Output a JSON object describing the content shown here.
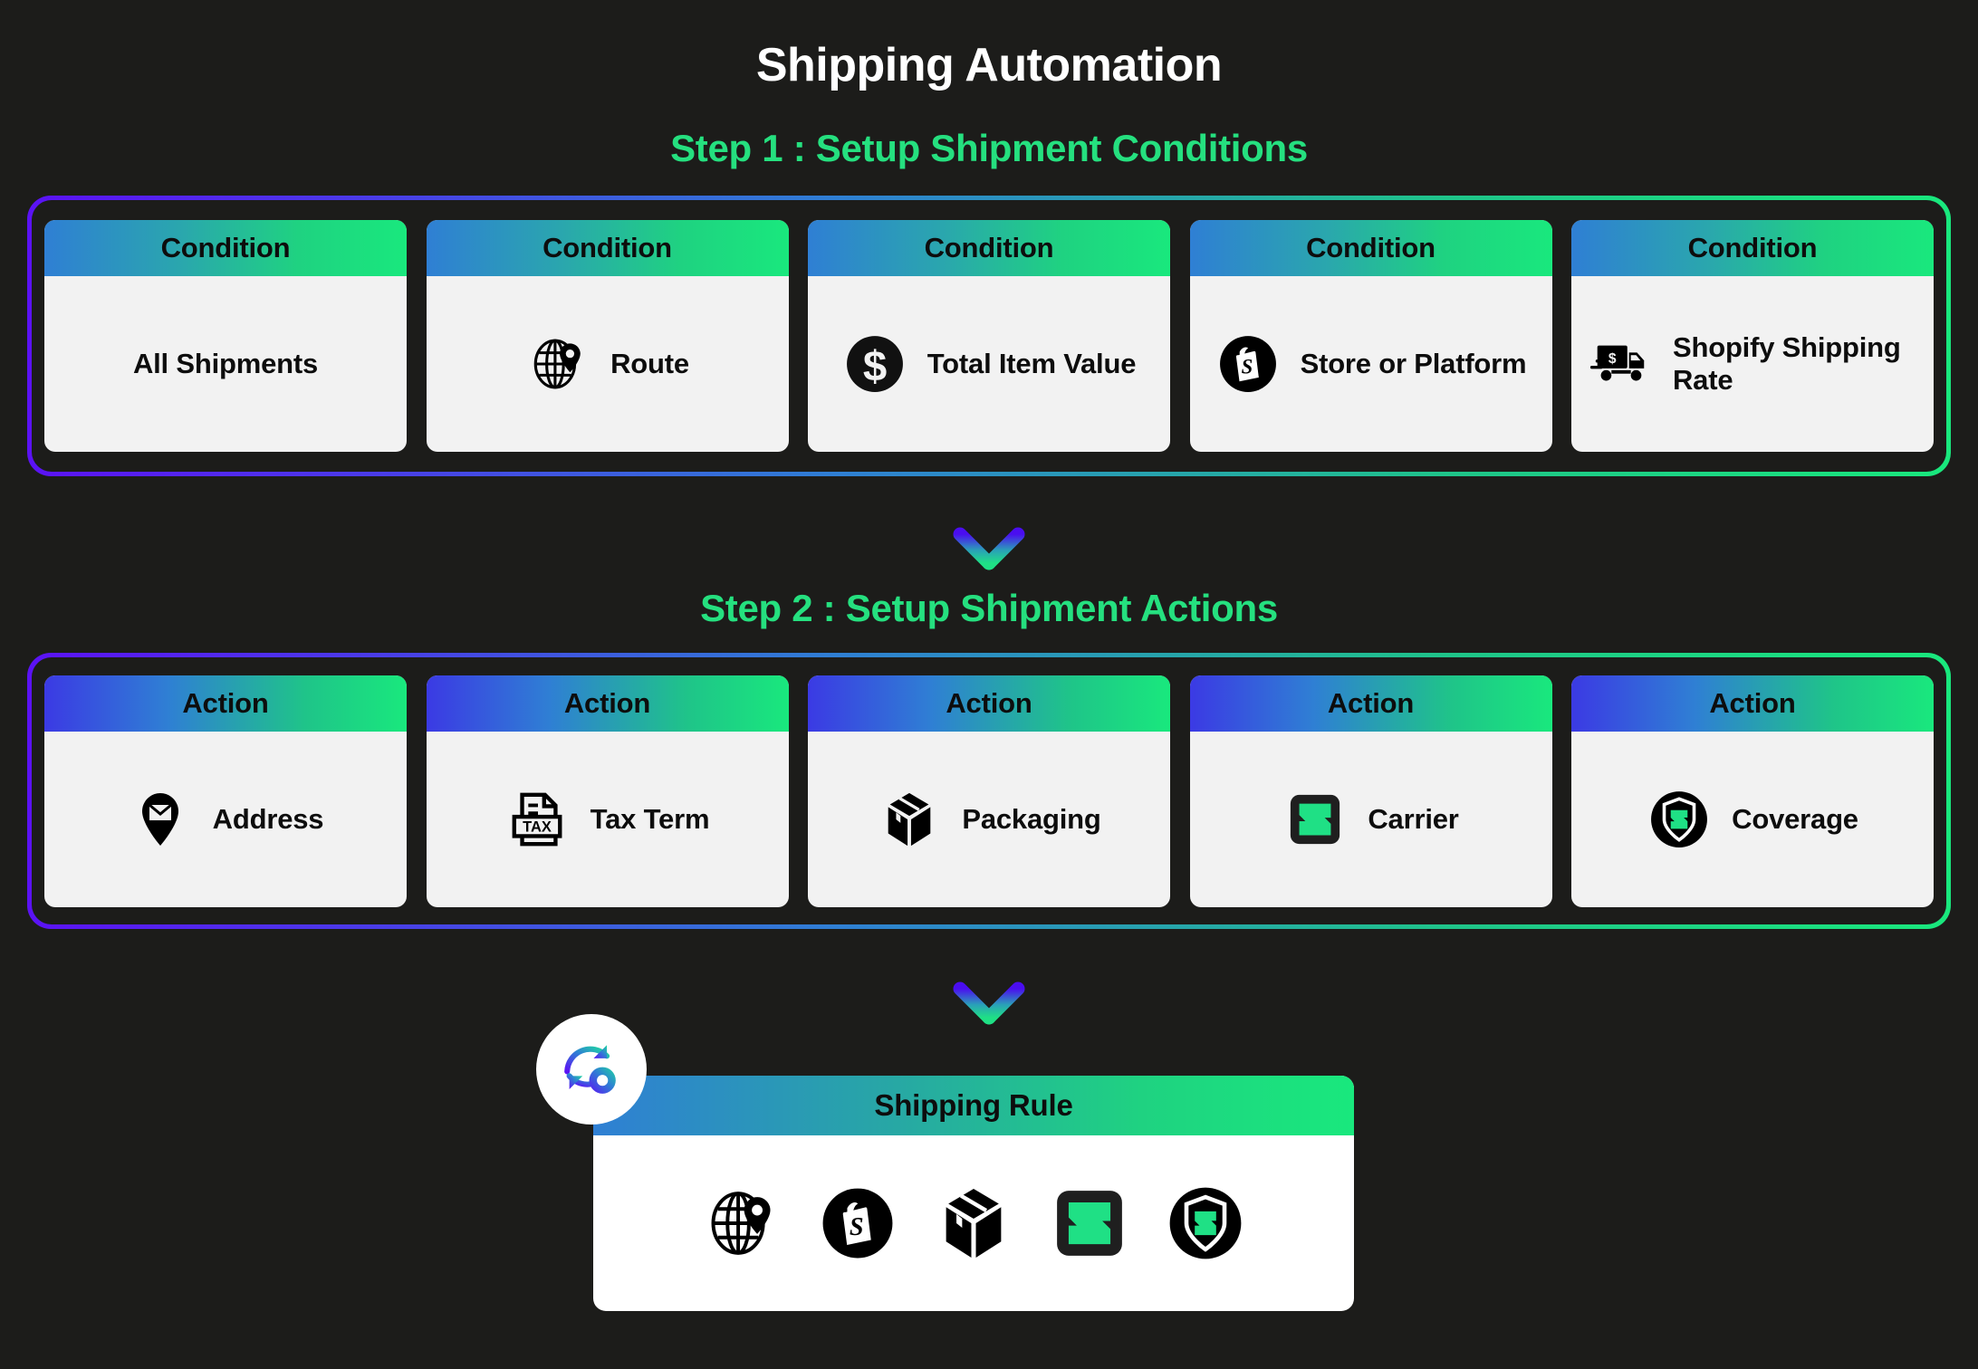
{
  "title": "Shipping Automation",
  "colors": {
    "background": "#1c1c1a",
    "accent_green": "#25e07f",
    "accent_purple": "#5b12f5",
    "accent_blue": "#2f7fd4",
    "card_surface": "#f2f2f2",
    "title_text": "#ffffff"
  },
  "step1": {
    "heading": "Step 1 : Setup Shipment Conditions",
    "cards": [
      {
        "header": "Condition",
        "label": "All Shipments",
        "icon": "none"
      },
      {
        "header": "Condition",
        "label": "Route",
        "icon": "globe-pin-icon"
      },
      {
        "header": "Condition",
        "label": "Total Item Value",
        "icon": "dollar-circle-icon"
      },
      {
        "header": "Condition",
        "label": "Store or Platform",
        "icon": "shopify-bag-icon"
      },
      {
        "header": "Condition",
        "label": "Shopify Shipping Rate",
        "icon": "delivery-truck-dollar-icon"
      }
    ]
  },
  "step2": {
    "heading": "Step 2 : Setup Shipment Actions",
    "cards": [
      {
        "header": "Action",
        "label": "Address",
        "icon": "mail-pin-icon"
      },
      {
        "header": "Action",
        "label": "Tax Term",
        "icon": "tax-document-icon"
      },
      {
        "header": "Action",
        "label": "Packaging",
        "icon": "package-box-icon"
      },
      {
        "header": "Action",
        "label": "Carrier",
        "icon": "carrier-square-icon"
      },
      {
        "header": "Action",
        "label": "Coverage",
        "icon": "shield-coverage-icon"
      }
    ]
  },
  "result": {
    "badge_icon": "refresh-gear-icon",
    "header": "Shipping Rule",
    "icons": [
      "globe-pin-icon",
      "shopify-bag-icon",
      "package-box-icon",
      "carrier-square-icon",
      "shield-coverage-icon"
    ]
  },
  "arrows": [
    {
      "name": "arrow-down-step1-to-step2"
    },
    {
      "name": "arrow-down-step2-to-rule"
    }
  ]
}
